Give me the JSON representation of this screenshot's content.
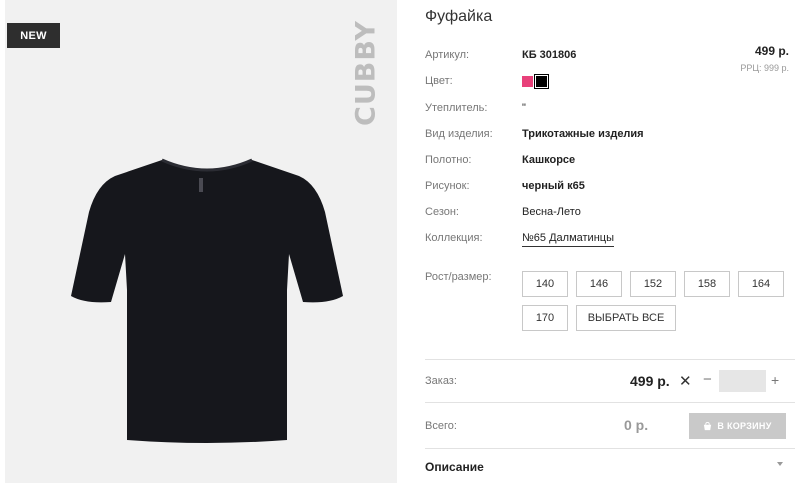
{
  "badge": "NEW",
  "brand": "CUBBY",
  "title": "Фуфайка",
  "price": "499 р.",
  "rrp": "РРЦ: 999 р.",
  "attributes": [
    {
      "label": "Артикул:",
      "value": "КБ 301806"
    },
    {
      "label": "Цвет:",
      "value": ""
    },
    {
      "label": "Утеплитель:",
      "value": "\""
    },
    {
      "label": "Вид изделия:",
      "value": "Трикотажные изделия"
    },
    {
      "label": "Полотно:",
      "value": "Кашкорсе"
    },
    {
      "label": "Рисунок:",
      "value": "черный к65"
    },
    {
      "label": "Сезон:",
      "value": "Весна-Лето"
    },
    {
      "label": "Коллекция:",
      "value": "№65 Далматинцы"
    }
  ],
  "colors": {
    "pink": "#e8417a",
    "black": "#000000"
  },
  "size_label": "Рост/размер:",
  "sizes": [
    "140",
    "146",
    "152",
    "158",
    "164",
    "170"
  ],
  "select_all": "ВЫБРАТЬ ВСЕ",
  "order": {
    "label": "Заказ:",
    "price": "499 р.",
    "times": "✕",
    "minus": "−",
    "plus": "+",
    "quantity": ""
  },
  "total": {
    "label": "Всего:",
    "value": "0 р."
  },
  "cart_button": "В КОРЗИНУ",
  "description_label": "Описание"
}
